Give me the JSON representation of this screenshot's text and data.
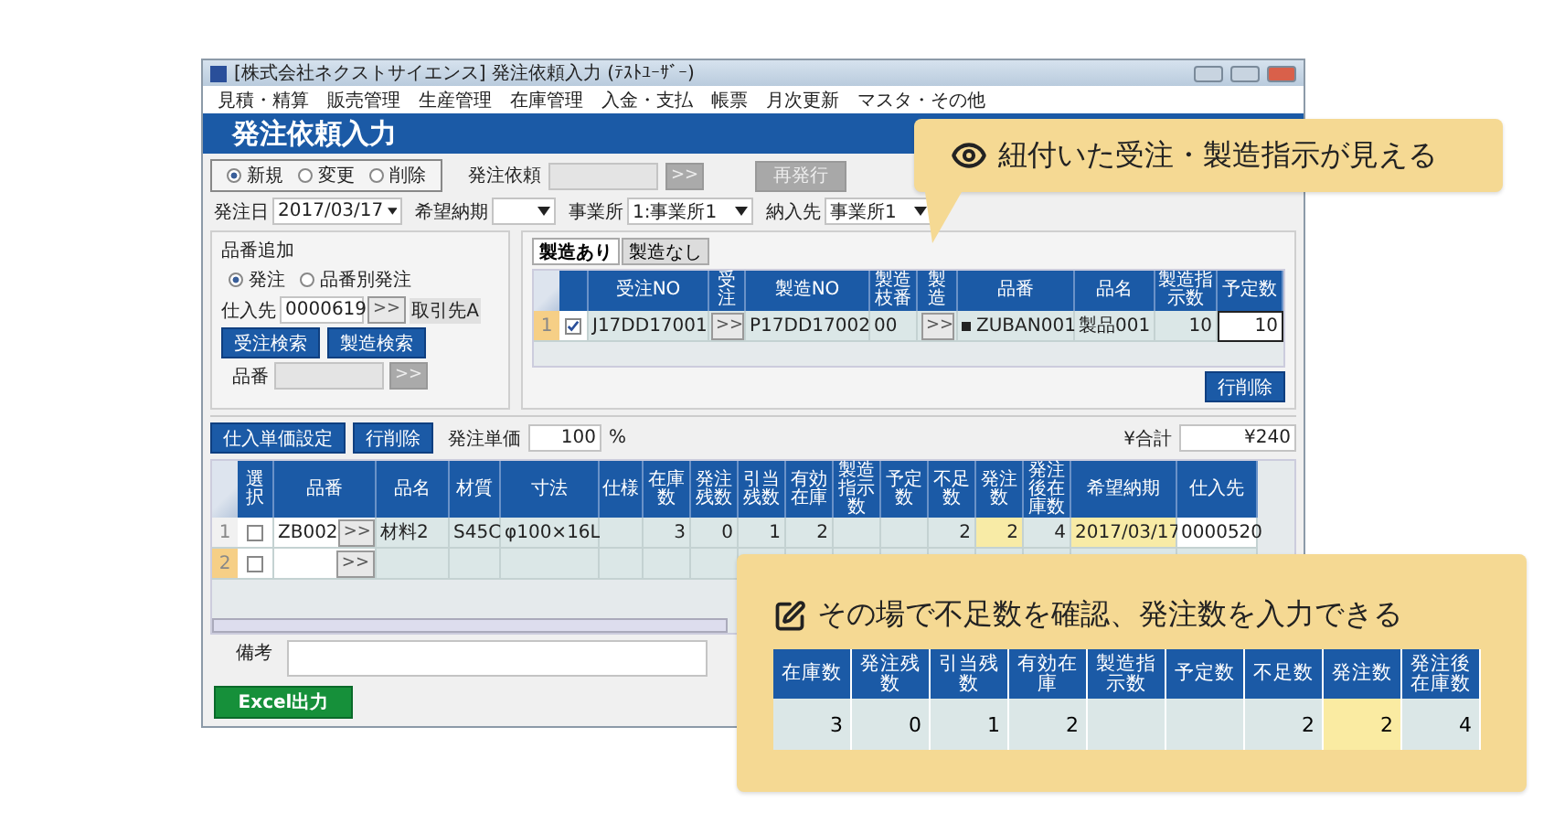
{
  "window": {
    "title": "[株式会社ネクストサイエンス] 発注依頼入力 (ﾃｽﾄﾕｰｻﾞｰ)"
  },
  "menu": [
    "見積・精算",
    "販売管理",
    "生産管理",
    "在庫管理",
    "入金・支払",
    "帳票",
    "月次更新",
    "マスタ・その他"
  ],
  "header": "発注依頼入力",
  "mode_options": [
    {
      "label": "新規",
      "selected": true
    },
    {
      "label": "変更",
      "selected": false
    },
    {
      "label": "削除",
      "selected": false
    }
  ],
  "request_field": {
    "label": "発注依頼",
    "button": ">>"
  },
  "reissue_button": {
    "label": "再発行",
    "disabled": true
  },
  "filters": [
    {
      "label": "発注日",
      "value": "2017/03/17"
    },
    {
      "label": "希望納期"
    },
    {
      "label": "事業所",
      "value": "1:事業所1"
    },
    {
      "label": "納入先",
      "value": "事業所1"
    }
  ],
  "add_panel": {
    "title": "品番追加",
    "order_options": [
      {
        "label": "発注",
        "selected": true
      },
      {
        "label": "品番別発注",
        "selected": false
      }
    ],
    "supplier": {
      "label": "仕入先",
      "value": "0000619",
      "button": ">>",
      "name": "取引先A"
    },
    "buttons": [
      "受注検索",
      "製造検索"
    ],
    "part": {
      "label": "品番",
      "button": ">>"
    }
  },
  "linked_panel": {
    "tabs": [
      {
        "label": "製造あり",
        "selected": true
      },
      {
        "label": "製造なし",
        "selected": false
      }
    ],
    "columns": [
      {
        "label": "受注NO",
        "kind": "text"
      },
      {
        "label": "受注",
        "kind": "button"
      },
      {
        "label": "製造NO",
        "kind": "text"
      },
      {
        "label": "製造枝番",
        "kind": "text"
      },
      {
        "label": "製造",
        "kind": "button"
      },
      {
        "label": "品番",
        "kind": "code"
      },
      {
        "label": "品名",
        "kind": "text"
      },
      {
        "label": "製造指示数",
        "kind": "number"
      },
      {
        "label": "予定数",
        "kind": "input"
      }
    ],
    "rows": [
      {
        "number": "1",
        "checked": true,
        "cells": [
          "J17DD17001",
          ">>",
          "P17DD17002",
          "00",
          ">>",
          "ZUBAN001",
          "製品001",
          "10",
          "10"
        ]
      }
    ],
    "delete_button": "行削除"
  },
  "toolbar": {
    "buttons": [
      "仕入単価設定",
      "行削除"
    ],
    "rate": {
      "label": "発注単価",
      "value": "100",
      "unit": "%"
    },
    "total": {
      "label": "¥合計",
      "value": "¥240"
    }
  },
  "grid": {
    "select_header": "選択",
    "columns": [
      {
        "label": "品番",
        "kind": "part",
        "button": ">>"
      },
      {
        "label": "品名",
        "kind": "text"
      },
      {
        "label": "材質",
        "kind": "text"
      },
      {
        "label": "寸法",
        "kind": "text"
      },
      {
        "label": "仕様",
        "kind": "text"
      },
      {
        "label": "在庫数",
        "kind": "number"
      },
      {
        "label": "発注残数",
        "kind": "number"
      },
      {
        "label": "引当残数",
        "kind": "number"
      },
      {
        "label": "有効在庫",
        "kind": "number"
      },
      {
        "label": "製造指示数",
        "kind": "number"
      },
      {
        "label": "予定数",
        "kind": "number"
      },
      {
        "label": "不足数",
        "kind": "number"
      },
      {
        "label": "発注数",
        "kind": "editable"
      },
      {
        "label": "発注後在庫数",
        "kind": "number"
      },
      {
        "label": "希望納期",
        "kind": "date"
      },
      {
        "label": "仕入先",
        "kind": "input"
      }
    ],
    "rows": [
      {
        "number": "1",
        "checked": false,
        "current": false,
        "cells": [
          "ZB002",
          "材料2",
          "S45C",
          "φ100×16L",
          null,
          "3",
          "0",
          "1",
          "2",
          null,
          null,
          "2",
          "2",
          "4",
          "2017/03/17",
          "0000520"
        ]
      },
      {
        "number": "2",
        "checked": false,
        "current": true,
        "cells": [
          null,
          null,
          null,
          null,
          null,
          null,
          null,
          null,
          null,
          null,
          null,
          null,
          null,
          null,
          null,
          null
        ]
      }
    ]
  },
  "remarks": {
    "label": "備考"
  },
  "excel_button": "Excel出力",
  "callouts": [
    {
      "kind": "eye",
      "text": "紐付いた受注・製造指示が見える"
    },
    {
      "kind": "edit",
      "text": "その場で不足数を確認、発注数を入力できる",
      "table": {
        "columns": [
          "在庫数",
          "発注残数",
          "引当残数",
          "有効在庫",
          "製造指示数",
          "予定数",
          "不足数",
          "発注数",
          "発注後在庫数"
        ],
        "cells": [
          {
            "value": "3",
            "highlighted": false
          },
          {
            "value": "0",
            "highlighted": false
          },
          {
            "value": "1",
            "highlighted": false
          },
          {
            "value": "2",
            "highlighted": false
          },
          {
            "highlighted": false
          },
          {
            "highlighted": false
          },
          {
            "value": "2",
            "highlighted": false
          },
          {
            "value": "2",
            "highlighted": true
          },
          {
            "value": "4",
            "highlighted": false
          }
        ]
      }
    }
  ]
}
